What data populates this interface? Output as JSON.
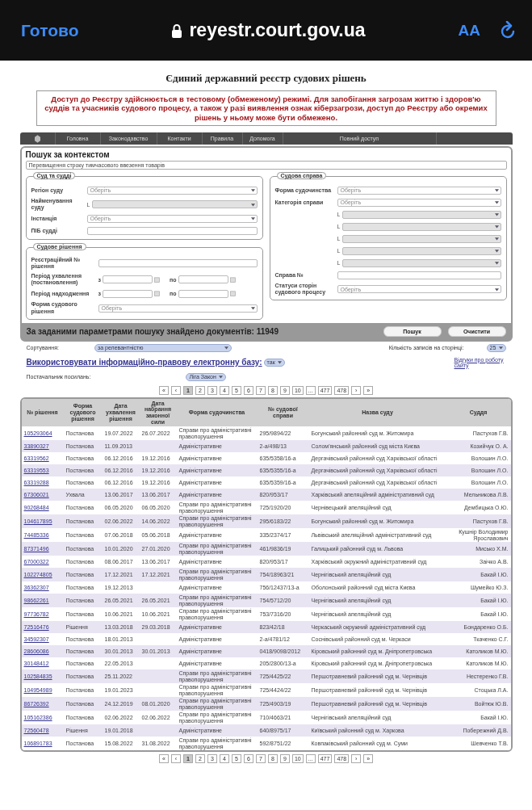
{
  "browser_bar": {
    "done": "Готово",
    "url": "reyestr.court.gov.ua",
    "text_size": "AA"
  },
  "title": "Єдиний державний реєстр судових рішень",
  "notice": "Доступ до Реєстру здійснюється в тестовому (обмеженому) режимі. Для запобігання загрозам життю і здоров'ю суддів та учасників судового процесу, а також у разі виявлення ознак кіберзагрози, доступ до Реєстру або окремих рішень у ньому може бути обмежено.",
  "nav": [
    {
      "label": "Головна"
    },
    {
      "label": "Законодавство"
    },
    {
      "label": "Контакти"
    },
    {
      "label": "Правила"
    },
    {
      "label": "Допомога"
    },
    {
      "label": "Повний доступ"
    }
  ],
  "search": {
    "title": "Пошук за контекстом",
    "query": "Перевищення строку тимчасового ввезення товарів",
    "court_group": {
      "legend": "Суд та судді",
      "fields": [
        {
          "kind": "select",
          "label": "Регіон суду",
          "placeholder": "Оберіть",
          "disabled": false
        },
        {
          "kind": "subselect",
          "label": "Найменування суду",
          "mark": "L",
          "disabled": true
        },
        {
          "kind": "select",
          "label": "Інстанція",
          "placeholder": "Оберіть",
          "disabled": false
        },
        {
          "kind": "input",
          "label": "ПІБ судді"
        }
      ]
    },
    "decision_group": {
      "legend": "Судове рішення",
      "fields": [
        {
          "kind": "input",
          "label": "Реєстраційний № рішення"
        },
        {
          "kind": "range",
          "label": "Період ухвалення (постановлення)",
          "from": "з",
          "to": "по"
        },
        {
          "kind": "range",
          "label": "Період надходження",
          "from": "з",
          "to": "по"
        },
        {
          "kind": "select",
          "label": "Форма судового рішення",
          "placeholder": "Оберіть",
          "disabled": false
        }
      ]
    },
    "case_group": {
      "legend": "Судова справа",
      "fields": [
        {
          "kind": "select",
          "label": "Форма судочинства",
          "placeholder": "Оберіть",
          "disabled": false
        },
        {
          "kind": "select",
          "label": "Категорія справи",
          "placeholder": "Оберіть",
          "disabled": false
        },
        {
          "kind": "subselect",
          "mark": "L",
          "disabled": true
        },
        {
          "kind": "subselect",
          "mark": "L",
          "disabled": true
        },
        {
          "kind": "subselect",
          "mark": "L",
          "disabled": true
        },
        {
          "kind": "subselect",
          "mark": "L",
          "disabled": true
        },
        {
          "kind": "subselect",
          "mark": "L",
          "disabled": true
        },
        {
          "kind": "input",
          "label": "Справа №"
        },
        {
          "kind": "select",
          "label": "Статуси сторін судового процесу",
          "placeholder": "Оберіть",
          "disabled": false
        }
      ]
    },
    "result_text": "За заданими параметрами пошуку знайдено документів: 11949",
    "buttons": [
      "Пошук",
      "Очистити"
    ]
  },
  "sorting": {
    "label": "Сортування:",
    "value": "за релевантністю",
    "page_size_label": "Кількість записів на сторінці:",
    "page_size": "25"
  },
  "legal_base": {
    "link": "Використовувати інформаційно-правову електронну базу:",
    "value": "так",
    "feedback": "Відгуки про роботу сайту"
  },
  "provider": {
    "label": "Постачальник посилань:",
    "value": "Ліга Закон"
  },
  "pagination_top": [
    {
      "label": "«",
      "selected": false
    },
    {
      "label": "‹",
      "selected": false
    },
    {
      "label": "1",
      "selected": true
    },
    {
      "label": "2",
      "selected": false
    },
    {
      "label": "3",
      "selected": false
    },
    {
      "label": "4",
      "selected": false
    },
    {
      "label": "5",
      "selected": false
    },
    {
      "label": "6",
      "selected": false
    },
    {
      "label": "7",
      "selected": false
    },
    {
      "label": "8",
      "selected": false
    },
    {
      "label": "9",
      "selected": false
    },
    {
      "label": "10",
      "selected": false
    },
    {
      "label": "...",
      "selected": false
    },
    {
      "label": "477",
      "selected": false
    },
    {
      "label": "478",
      "selected": false
    },
    {
      "label": "›",
      "selected": false
    },
    {
      "label": "»",
      "selected": false
    }
  ],
  "table": {
    "columns": [
      "№ рішення",
      "Форма судового рішення",
      "Дата ухвалення рішення",
      "Дата набрання законної сили",
      "Форма судочинства",
      "№ судової справи",
      "Назва суду",
      "Суддя"
    ],
    "rows": [
      [
        "105293064",
        "Постанова",
        "19.07.2022",
        "26.07.2022",
        "Справи про адміністративні правопорушення",
        "295/9894/22",
        "Богунський районний суд м. Житомира",
        "Пастухов Г.В."
      ],
      [
        "33890327",
        "Постанова",
        "11.09.2013",
        "",
        "Адміністративне",
        "2-а/498/13",
        "Солом'янський районний суд міста Києва",
        "Козийчук О. А."
      ],
      [
        "63319562",
        "Постанова",
        "06.12.2016",
        "19.12.2016",
        "Адміністративне",
        "635/5358/16-а",
        "Дергачівський районний суд Харківської області",
        "Волошин Л.О."
      ],
      [
        "63319553",
        "Постанова",
        "06.12.2016",
        "19.12.2016",
        "Адміністративне",
        "635/5355/16-а",
        "Дергачівський районний суд Харківської області",
        "Волошин Л.О."
      ],
      [
        "63319288",
        "Постанова",
        "06.12.2016",
        "19.12.2016",
        "Адміністративне",
        "635/5359/16-а",
        "Дергачівський районний суд Харківської області",
        "Волошин Л.О."
      ],
      [
        "67306021",
        "Ухвала",
        "13.06.2017",
        "13.06.2017",
        "Адміністративне",
        "820/953/17",
        "Харківський апеляційний адміністративний суд",
        "Мельникова Л.В."
      ],
      [
        "90268484",
        "Постанова",
        "06.05.2020",
        "06.05.2020",
        "Справи про адміністративні правопорушення",
        "725/1920/20",
        "Чернівецький апеляційний суд",
        "Дембицька О.Ю."
      ],
      [
        "104617895",
        "Постанова",
        "02.06.2022",
        "14.06.2022",
        "Справи про адміністративні правопорушення",
        "295/6183/22",
        "Богунський районний суд м. Житомира",
        "Пастухов Г.В."
      ],
      [
        "74485336",
        "Постанова",
        "07.06.2018",
        "05.06.2018",
        "Адміністративне",
        "335/2374/17",
        "Львівський апеляційний адміністративний суд",
        "Кушнір Володимир Ярославович"
      ],
      [
        "87371496",
        "Постанова",
        "10.01.2020",
        "27.01.2020",
        "Справи про адміністративні правопорушення",
        "461/9836/19",
        "Галицький районний суд м. Львова",
        "Мисько Х.М."
      ],
      [
        "67000322",
        "Постанова",
        "08.06.2017",
        "13.06.2017",
        "Адміністративне",
        "820/953/17",
        "Харківський окружний адміністративний суд",
        "Заічко А.В."
      ],
      [
        "102274805",
        "Постанова",
        "17.12.2021",
        "17.12.2021",
        "Справи про адміністративні правопорушення",
        "754/18963/21",
        "Чернігівський апеляційний суд",
        "Бакай І.Ю."
      ],
      [
        "36362307",
        "Постанова",
        "19.12.2013",
        "",
        "Адміністративне",
        "756/12437/13-а",
        "Оболонський районний суд міста Києва",
        "Шумейко Ю.З."
      ],
      [
        "98662261",
        "Постанова",
        "26.05.2021",
        "26.05.2021",
        "Справи про адміністративні правопорушення",
        "754/5712/20",
        "Чернігівський апеляційний суд",
        "Бакай І.Ю."
      ],
      [
        "97736782",
        "Постанова",
        "10.06.2021",
        "10.06.2021",
        "Справи про адміністративні правопорушення",
        "753/7316/20",
        "Чернігівський апеляційний суд",
        "Бакай І.Ю."
      ],
      [
        "72516476",
        "Рішення",
        "13.03.2018",
        "29.03.2018",
        "Адміністративне",
        "823/42/18",
        "Черкаський окружний адміністративний суд",
        "Бондаренко О.Б."
      ],
      [
        "34592307",
        "Постанова",
        "18.01.2013",
        "",
        "Адміністративне",
        "2-а/4781/12",
        "Соснівський районний суд м. Черкаси",
        "Ткаченко С.Г."
      ],
      [
        "28606086",
        "Постанова",
        "30.01.2013",
        "30.01.2013",
        "Адміністративне",
        "0418/9098/2012",
        "Кіровський районний суд м. Дніпропетровська",
        "Католиков М.Ю."
      ],
      [
        "30148412",
        "Постанова",
        "22.05.2013",
        "",
        "Адміністративне",
        "205/2800/13-а",
        "Кіровський районний суд м. Дніпропетровська",
        "Католиков М.Ю."
      ],
      [
        "102584835",
        "Постанова",
        "25.11.2022",
        "",
        "Справи про адміністративні правопорушення",
        "725/4425/22",
        "Першотравневий районний суд м. Чернівців",
        "Нестеренко Г.В."
      ],
      [
        "104954989",
        "Постанова",
        "19.01.2023",
        "",
        "Справи про адміністративні правопорушення",
        "725/4424/22",
        "Першотравневий районний суд м. Чернівців",
        "Стоцька Л.А."
      ],
      [
        "86726392",
        "Постанова",
        "24.12.2019",
        "08.01.2020",
        "Справи про адміністративні правопорушення",
        "725/4903/19",
        "Першотравневий районний суд м. Чернівців",
        "Войтюк Ю.В."
      ],
      [
        "105162386",
        "Постанова",
        "02.06.2022",
        "02.06.2022",
        "Справи про адміністративні правопорушення",
        "710/4663/21",
        "Чернігівський апеляційний суд",
        "Бакай І.Ю."
      ],
      [
        "72560478",
        "Рішення",
        "19.01.2018",
        "",
        "Адміністративне",
        "640/8975/17",
        "Київський районний суд м. Харкова",
        "Побережний Д.В."
      ],
      [
        "106891783",
        "Постанова",
        "15.08.2022",
        "31.08.2022",
        "Справи про адміністративні правопорушення",
        "592/8751/22",
        "Ковпаківський районний суд м. Суми",
        "Шевченко Т.В."
      ]
    ]
  },
  "pagination_bottom": [
    {
      "label": "«",
      "selected": false
    },
    {
      "label": "‹",
      "selected": false
    },
    {
      "label": "1",
      "selected": true
    },
    {
      "label": "2",
      "selected": false
    },
    {
      "label": "3",
      "selected": false
    },
    {
      "label": "4",
      "selected": false
    },
    {
      "label": "5",
      "selected": false
    },
    {
      "label": "6",
      "selected": false
    },
    {
      "label": "7",
      "selected": false
    },
    {
      "label": "8",
      "selected": false
    },
    {
      "label": "9",
      "selected": false
    },
    {
      "label": "10",
      "selected": false
    },
    {
      "label": "...",
      "selected": false
    },
    {
      "label": "477",
      "selected": false
    },
    {
      "label": "478",
      "selected": false
    },
    {
      "label": "›",
      "selected": false
    },
    {
      "label": "»",
      "selected": false
    }
  ]
}
